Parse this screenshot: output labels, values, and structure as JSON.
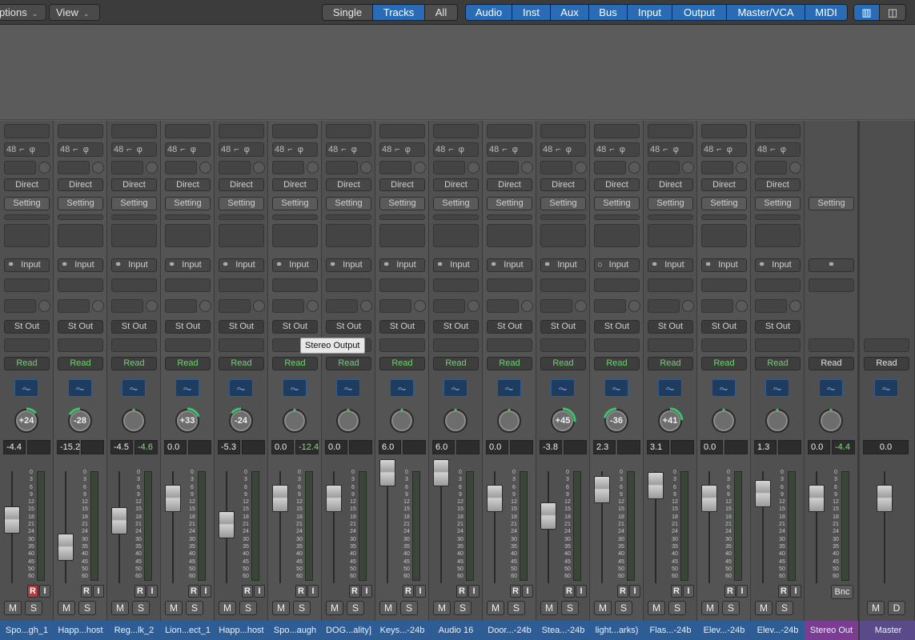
{
  "toolbar": {
    "options_label": "ptions",
    "view_label": "View",
    "scope_tabs": [
      "Single",
      "Tracks",
      "All"
    ],
    "scope_selected": "Tracks",
    "filter_tabs": [
      "Audio",
      "Inst",
      "Aux",
      "Bus",
      "Input",
      "Output",
      "Master/VCA",
      "MIDI"
    ],
    "filter_selected": [
      "Audio",
      "Inst",
      "Aux",
      "Bus",
      "Input",
      "Output",
      "Master/VCA",
      "MIDI"
    ],
    "layout_icons": [
      "single-strip-icon",
      "wide-strip-icon"
    ]
  },
  "labels": {
    "input_format": "48",
    "direct": "Direct",
    "setting": "Setting",
    "input": "Input",
    "mute": "M",
    "solo": "S",
    "rec": "R",
    "monitor": "I",
    "dim": "D",
    "bounce": "Bnc"
  },
  "tooltip": "Stereo Output",
  "meter_scale": [
    "0",
    "3",
    "6",
    "9",
    "12",
    "15",
    "18",
    "21",
    "24",
    "30",
    "35",
    "40",
    "45",
    "50",
    "60"
  ],
  "channels": [
    {
      "name": "Spo...gh_1",
      "output": "St Out",
      "automation": "Read",
      "pan": "+24",
      "pan_value": 24,
      "volume": "-4.4",
      "peak": "",
      "fader_db": -4.4,
      "record_armed": true
    },
    {
      "name": "Happ...host",
      "output": "St Out",
      "automation": "Read",
      "pan": "-28",
      "pan_value": -28,
      "volume": "-15.2",
      "peak": "",
      "fader_db": -15.2,
      "record_armed": false
    },
    {
      "name": "Reg...lk_2",
      "output": "St Out",
      "automation": "Read",
      "pan": "",
      "pan_value": 0,
      "volume": "-4.5",
      "peak": "-4.6",
      "fader_db": -4.5,
      "record_armed": false
    },
    {
      "name": "Lion...ect_1",
      "output": "St Out",
      "automation": "Read",
      "pan": "+33",
      "pan_value": 33,
      "volume": "0.0",
      "peak": "",
      "fader_db": 0.0,
      "record_armed": false
    },
    {
      "name": "Happ...host",
      "output": "St Out",
      "automation": "Read",
      "pan": "-24",
      "pan_value": -24,
      "volume": "-5.3",
      "peak": "",
      "fader_db": -5.3,
      "record_armed": false
    },
    {
      "name": "Spo...augh",
      "output": "St Out",
      "automation": "Read",
      "pan": "",
      "pan_value": 0,
      "volume": "0.0",
      "peak": "-12.4",
      "fader_db": 0.0,
      "record_armed": false
    },
    {
      "name": "DOG...ality]",
      "output": "St Out",
      "automation": "Read",
      "pan": "",
      "pan_value": 0,
      "volume": "0.0",
      "peak": "",
      "fader_db": 0.0,
      "record_armed": false
    },
    {
      "name": "Keys...-24b",
      "output": "St Out",
      "automation": "Read",
      "pan": "",
      "pan_value": 0,
      "volume": "6.0",
      "peak": "",
      "fader_db": 6.0,
      "record_armed": false
    },
    {
      "name": "Audio 16",
      "output": "St Out",
      "automation": "Read",
      "pan": "",
      "pan_value": 0,
      "volume": "6.0",
      "peak": "",
      "fader_db": 6.0,
      "record_armed": false
    },
    {
      "name": "Door...-24b",
      "output": "St Out",
      "automation": "Read",
      "pan": "",
      "pan_value": 0,
      "volume": "0.0",
      "peak": "",
      "fader_db": 0.0,
      "record_armed": false
    },
    {
      "name": "Stea...-24b",
      "output": "St Out",
      "automation": "Read",
      "pan": "+45",
      "pan_value": 45,
      "volume": "-3.8",
      "peak": "",
      "fader_db": -3.8,
      "record_armed": false
    },
    {
      "name": "light...arks)",
      "output": "St Out",
      "automation": "Read",
      "pan": "-36",
      "pan_value": -36,
      "volume": "2.3",
      "peak": "",
      "fader_db": 2.3,
      "record_armed": false
    },
    {
      "name": "Flas...-24b",
      "output": "St Out",
      "automation": "Read",
      "pan": "+41",
      "pan_value": 41,
      "volume": "3.1",
      "peak": "",
      "fader_db": 3.1,
      "record_armed": false
    },
    {
      "name": "Elev...-24b",
      "output": "St Out",
      "automation": "Read",
      "pan": "",
      "pan_value": 0,
      "volume": "0.0",
      "peak": "",
      "fader_db": 0.0,
      "record_armed": false
    },
    {
      "name": "Elev...-24b",
      "output": "St Out",
      "automation": "Read",
      "pan": "",
      "pan_value": 0,
      "volume": "1.3",
      "peak": "",
      "fader_db": 1.3,
      "record_armed": false
    }
  ],
  "stereo_out": {
    "name": "Stereo Out",
    "automation": "Read",
    "setting": "Setting",
    "volume": "0.0",
    "peak": "-4.4",
    "fader_db": 0.0
  },
  "master": {
    "name": "Master",
    "automation": "Read",
    "volume": "0.0",
    "fader_db": 0.0
  },
  "colors": {
    "selected_blue": "#2a6bb5",
    "track_name_blue": "#2d5d94",
    "stereo_out_purple": "#7a3d92",
    "master_violet": "#5a4a8a",
    "read_green": "#6dd36d",
    "pan_green": "#3ec46d",
    "record_red": "#b23b3b"
  }
}
